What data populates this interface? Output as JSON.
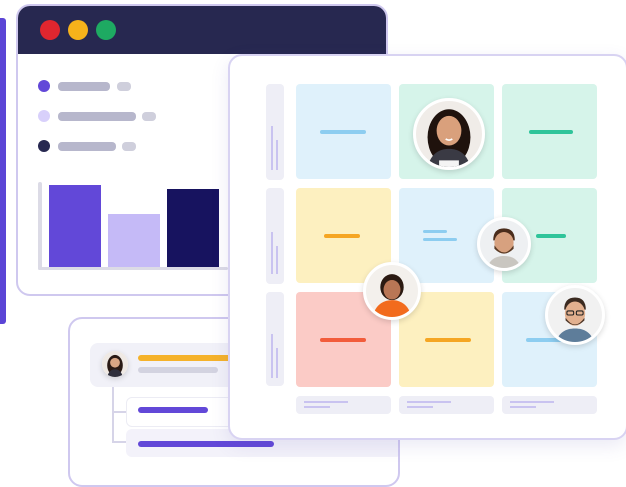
{
  "colors": {
    "brand_purple": "#5b45d6",
    "titlebar": "#272850",
    "traffic_red": "#e0262f",
    "traffic_yellow": "#f6b21b",
    "traffic_green": "#1eaa62",
    "bar_primary": "#6248d8",
    "bar_light": "#c5baf7",
    "bar_dark": "#17135f",
    "cell_blue": "#dff1fb",
    "cell_green": "#d6f4ea",
    "cell_yellow": "#fdf0c0",
    "cell_red": "#fbcbc6",
    "dash_blue": "#8dcdf0",
    "dash_green": "#2fc49a",
    "dash_orange": "#f5a623",
    "dash_red": "#f25c3b"
  },
  "chart_data": {
    "type": "bar",
    "categories": [
      "",
      "",
      ""
    ],
    "values": [
      82,
      53,
      78
    ],
    "ylim": [
      0,
      100
    ],
    "grid": false,
    "series_colors": [
      "#6248d8",
      "#c5baf7",
      "#17135f"
    ]
  },
  "icons": {
    "avatars": [
      "woman-avatar-icon",
      "bearded-man-avatar-icon",
      "woman-orange-avatar-icon",
      "man-glasses-avatar-icon",
      "woman-small-avatar-icon"
    ]
  }
}
